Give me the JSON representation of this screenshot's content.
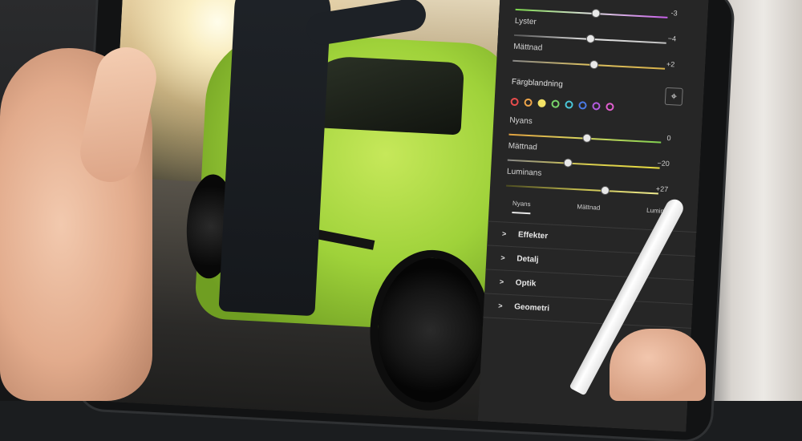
{
  "panel": {
    "sliders_top": [
      {
        "label": "",
        "value": "-3",
        "knob": 0.5
      },
      {
        "label": "Lyster",
        "value": "−4",
        "knob": 0.48
      },
      {
        "label": "Mättnad",
        "value": "+2",
        "knob": 0.51
      }
    ],
    "color_mix": {
      "title": "Färgblandning",
      "target_icon": "target-icon",
      "swatches": [
        "#e84c4c",
        "#f0a64a",
        "#f3e265",
        "#ffffff",
        "#78d46a",
        "#4ac6d8",
        "#4b7be6",
        "#b35ce0",
        "#e25fd0"
      ],
      "sliders": [
        {
          "label": "Nyans",
          "value": "0",
          "knob": 0.5
        },
        {
          "label": "Mättnad",
          "value": "−20",
          "knob": 0.38
        },
        {
          "label": "Luminans",
          "value": "+27",
          "knob": 0.63
        }
      ],
      "tabs": [
        "Nyans",
        "Mättnad",
        "Luminans"
      ],
      "active_tab": "Nyans"
    },
    "sections": [
      "Effekter",
      "Detalj",
      "Optik",
      "Geometri"
    ]
  }
}
